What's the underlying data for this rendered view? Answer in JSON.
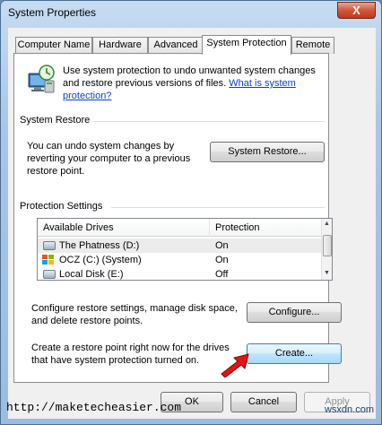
{
  "window": {
    "title": "System Properties",
    "close_label": "X"
  },
  "tabs": [
    {
      "label": "Computer Name"
    },
    {
      "label": "Hardware"
    },
    {
      "label": "Advanced"
    },
    {
      "label": "System Protection"
    },
    {
      "label": "Remote"
    }
  ],
  "intro": {
    "text": "Use system protection to undo unwanted system changes and restore previous versions of files. ",
    "link": "What is system protection?"
  },
  "system_restore": {
    "group_title": "System Restore",
    "description": "You can undo system changes by reverting your computer to a previous restore point.",
    "button_label": "System Restore..."
  },
  "protection_settings": {
    "group_title": "Protection Settings",
    "columns": [
      "Available Drives",
      "Protection"
    ],
    "drives": [
      {
        "name": "The Phatness (D:)",
        "protection": "On",
        "icon": "drive-icon"
      },
      {
        "name": "OCZ (C:) (System)",
        "protection": "On",
        "icon": "windows-drive-icon"
      },
      {
        "name": "Local Disk (E:)",
        "protection": "Off",
        "icon": "drive-icon"
      }
    ],
    "configure_text": "Configure restore settings, manage disk space, and delete restore points.",
    "configure_label": "Configure...",
    "create_text": "Create a restore point right now for the drives that have system protection turned on.",
    "create_label": "Create..."
  },
  "footer": {
    "ok_label": "OK",
    "cancel_label": "Cancel",
    "apply_label": "Apply"
  },
  "watermark": {
    "url": "http://maketecheasier.com",
    "site": "wsxdn.com"
  }
}
